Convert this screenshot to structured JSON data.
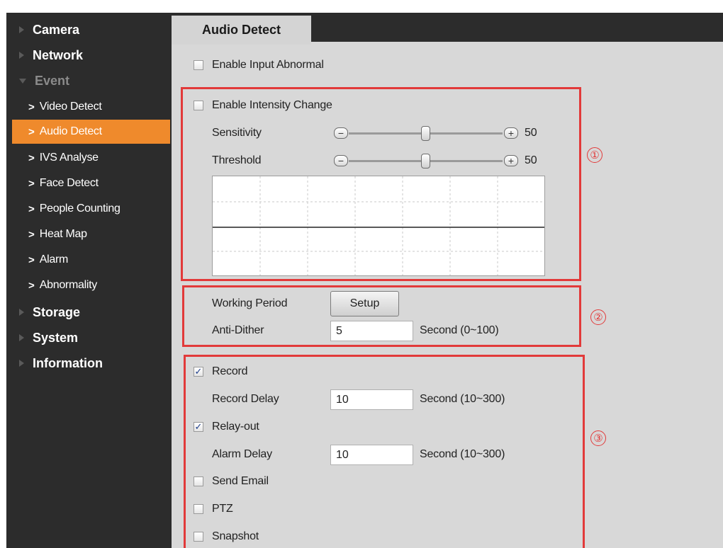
{
  "sidebar": {
    "camera": "Camera",
    "network": "Network",
    "event": "Event",
    "video_detect": "Video Detect",
    "audio_detect": "Audio Detect",
    "ivs_analyse": "IVS Analyse",
    "face_detect": "Face Detect",
    "people_counting": "People Counting",
    "heat_map": "Heat Map",
    "alarm": "Alarm",
    "abnormality": "Abnormality",
    "storage": "Storage",
    "system": "System",
    "information": "Information"
  },
  "tab": {
    "label": "Audio Detect"
  },
  "input_abnormal": {
    "label": "Enable Input Abnormal",
    "checked": false
  },
  "intensity": {
    "label": "Enable Intensity Change",
    "checked": false,
    "sensitivity": {
      "label": "Sensitivity",
      "value": "50",
      "fraction": 0.5
    },
    "threshold": {
      "label": "Threshold",
      "value": "50",
      "fraction": 0.5
    },
    "minus": "−",
    "plus": "+"
  },
  "working_period": {
    "label": "Working Period",
    "button": "Setup"
  },
  "anti_dither": {
    "label": "Anti-Dither",
    "value": "5",
    "unit": "Second (0~100)"
  },
  "record": {
    "label": "Record",
    "checked": true
  },
  "record_delay": {
    "label": "Record Delay",
    "value": "10",
    "unit": "Second (10~300)"
  },
  "relay_out": {
    "label": "Relay-out",
    "checked": true
  },
  "alarm_delay": {
    "label": "Alarm Delay",
    "value": "10",
    "unit": "Second (10~300)"
  },
  "send_email": {
    "label": "Send Email",
    "checked": false
  },
  "ptz": {
    "label": "PTZ",
    "checked": false
  },
  "snapshot": {
    "label": "Snapshot",
    "checked": false
  },
  "annotations": {
    "one": "①",
    "two": "②",
    "three": "③"
  },
  "colors": {
    "accent": "#ef8a2c",
    "sidebar": "#2c2c2c",
    "annotation": "#e23a3a",
    "content": "#d8d8d8"
  }
}
